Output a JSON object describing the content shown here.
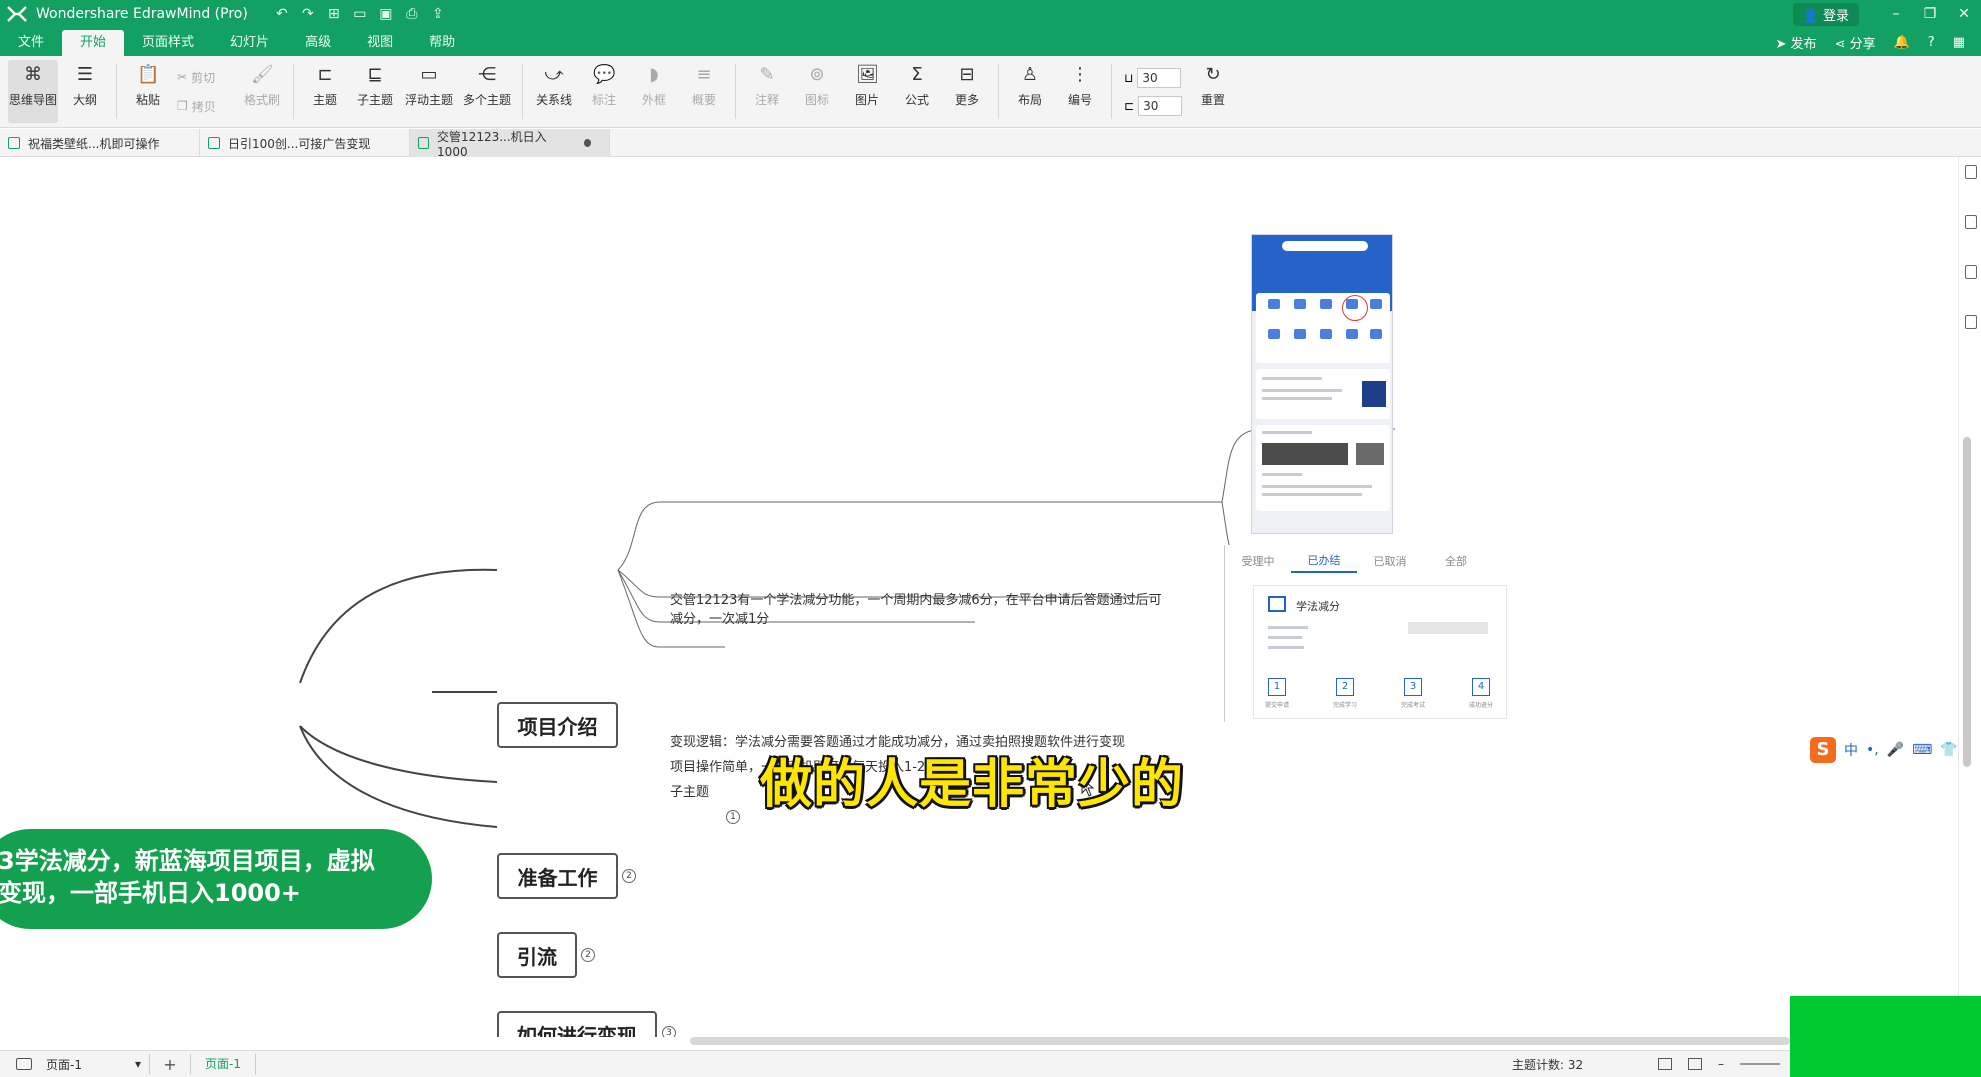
{
  "window": {
    "title": "Wondershare EdrawMind (Pro)",
    "login_label": "登录",
    "controls": [
      "–",
      "❐",
      "✕"
    ]
  },
  "quick_access": [
    "↶",
    "↷",
    "⊞",
    "▭",
    "▣",
    "⎙",
    "⇪"
  ],
  "menu": {
    "tabs": [
      "文件",
      "开始",
      "页面样式",
      "幻灯片",
      "高级",
      "视图",
      "帮助"
    ],
    "active": "开始",
    "publish": "发布",
    "share": "分享"
  },
  "ribbon": {
    "mindmap": "思维导图",
    "outline": "大纲",
    "paste": "粘贴",
    "cut": "剪切",
    "copy": "拷贝",
    "format_painter": "格式刷",
    "topic": "主题",
    "subtopic": "子主题",
    "floating_topic": "浮动主题",
    "multiple_topics": "多个主题",
    "relationship": "关系线",
    "callout": "标注",
    "boundary": "外框",
    "summary": "概要",
    "note": "注释",
    "icon": "图标",
    "picture": "图片",
    "formula": "公式",
    "more": "更多",
    "layout": "布局",
    "numbering": "编号",
    "spacing_h": "30",
    "spacing_v": "30",
    "reset": "重置"
  },
  "doc_tabs": [
    {
      "label": "祝福类壁纸...机即可操作"
    },
    {
      "label": "日引100创...可接广告变现"
    },
    {
      "label": "交管12123...机日入1000"
    }
  ],
  "mindmap": {
    "central": {
      "line1": "3学法减分，新蓝海项目项目，虚拟",
      "line2": "变现，一部手机日入1000+"
    },
    "topics": {
      "intro": "项目介绍",
      "prep": "准备工作",
      "traffic": "引流",
      "monetize": "如何进行变现"
    },
    "badges": {
      "prep": "2",
      "traffic": "2",
      "monetize": "3",
      "subtopic": "1"
    },
    "subtopics": {
      "s1_line1": "交管12123有一个学法减分功能，一个周期内最多减6分，在平台申请后答题通过后可",
      "s1_line2": "减分，一次减1分",
      "s2": "变现逻辑：学法减分需要答题通过才能成功减分，通过卖拍照搜题软件进行变现",
      "s3": "项目操作简单，一部手机即可，每天投入1-2小时",
      "s4": "子主题"
    }
  },
  "embedded_panel": {
    "tabs": [
      "受理中",
      "已办结",
      "已取消",
      "全部"
    ],
    "active_tab": "已办结",
    "card_title": "学法减分",
    "steps": [
      {
        "num": "1",
        "label": "提交申请"
      },
      {
        "num": "2",
        "label": "完成学习"
      },
      {
        "num": "3",
        "label": "完成考试"
      },
      {
        "num": "4",
        "label": "成功退分"
      }
    ]
  },
  "caption": "做的人是非常少的",
  "ime": {
    "logo": "S",
    "mode": "中"
  },
  "status": {
    "page_select": "页面-1",
    "page_tab": "页面-1",
    "topic_count_label": "主题计数:",
    "topic_count": "32"
  },
  "colors": {
    "brand_green": "#13a163",
    "central_fill": "#14a14f",
    "caption_yellow": "#ffe600"
  }
}
